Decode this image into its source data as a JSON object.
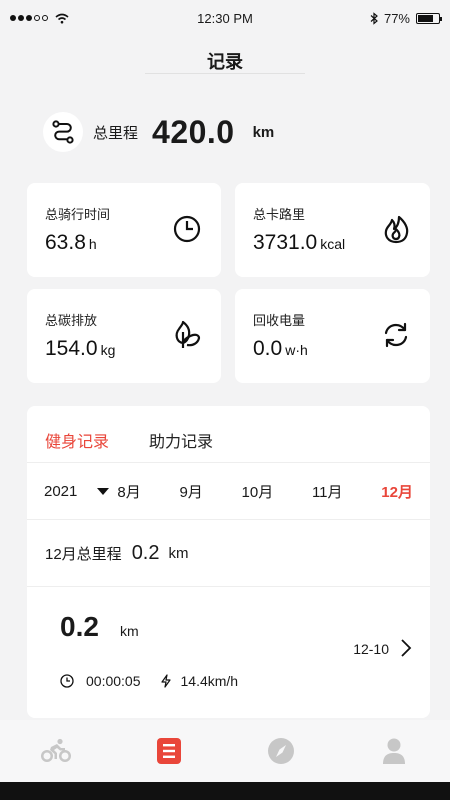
{
  "status_bar": {
    "time": "12:30 PM",
    "battery": "77%",
    "battery_level": 0.77
  },
  "nav": {
    "title": "记录"
  },
  "total": {
    "label": "总里程",
    "value": "420.0",
    "unit": "km"
  },
  "stats": [
    {
      "label": "总骑行时间",
      "value": "63.8",
      "unit": "h",
      "icon": "clock-icon"
    },
    {
      "label": "总卡路里",
      "value": "3731.0",
      "unit": "kcal",
      "icon": "flame-icon"
    },
    {
      "label": "总碳排放",
      "value": "154.0",
      "unit": "kg",
      "icon": "leaf-icon"
    },
    {
      "label": "回收电量",
      "value": "0.0",
      "unit": "w·h",
      "icon": "refresh-icon"
    }
  ],
  "records": {
    "tabs": [
      "健身记录",
      "助力记录"
    ],
    "active_tab": 0,
    "year": "2021",
    "months": [
      "8月",
      "9月",
      "10月",
      "11月",
      "12月"
    ],
    "active_month": 4,
    "month_summary": {
      "label": "12月总里程",
      "value": "0.2",
      "unit": "km"
    },
    "ride": {
      "distance": "0.2",
      "unit": "km",
      "date": "12-10",
      "duration": "00:00:05",
      "speed": "14.4km/h"
    }
  },
  "tabbar": [
    {
      "icon": "bicycle-icon",
      "active": false
    },
    {
      "icon": "records-icon",
      "active": true
    },
    {
      "icon": "compass-icon",
      "active": false
    },
    {
      "icon": "profile-icon",
      "active": false
    }
  ],
  "colors": {
    "accent": "#e9463a",
    "background": "#f3f3f4",
    "inactive_icon": "#c7c7c7"
  }
}
